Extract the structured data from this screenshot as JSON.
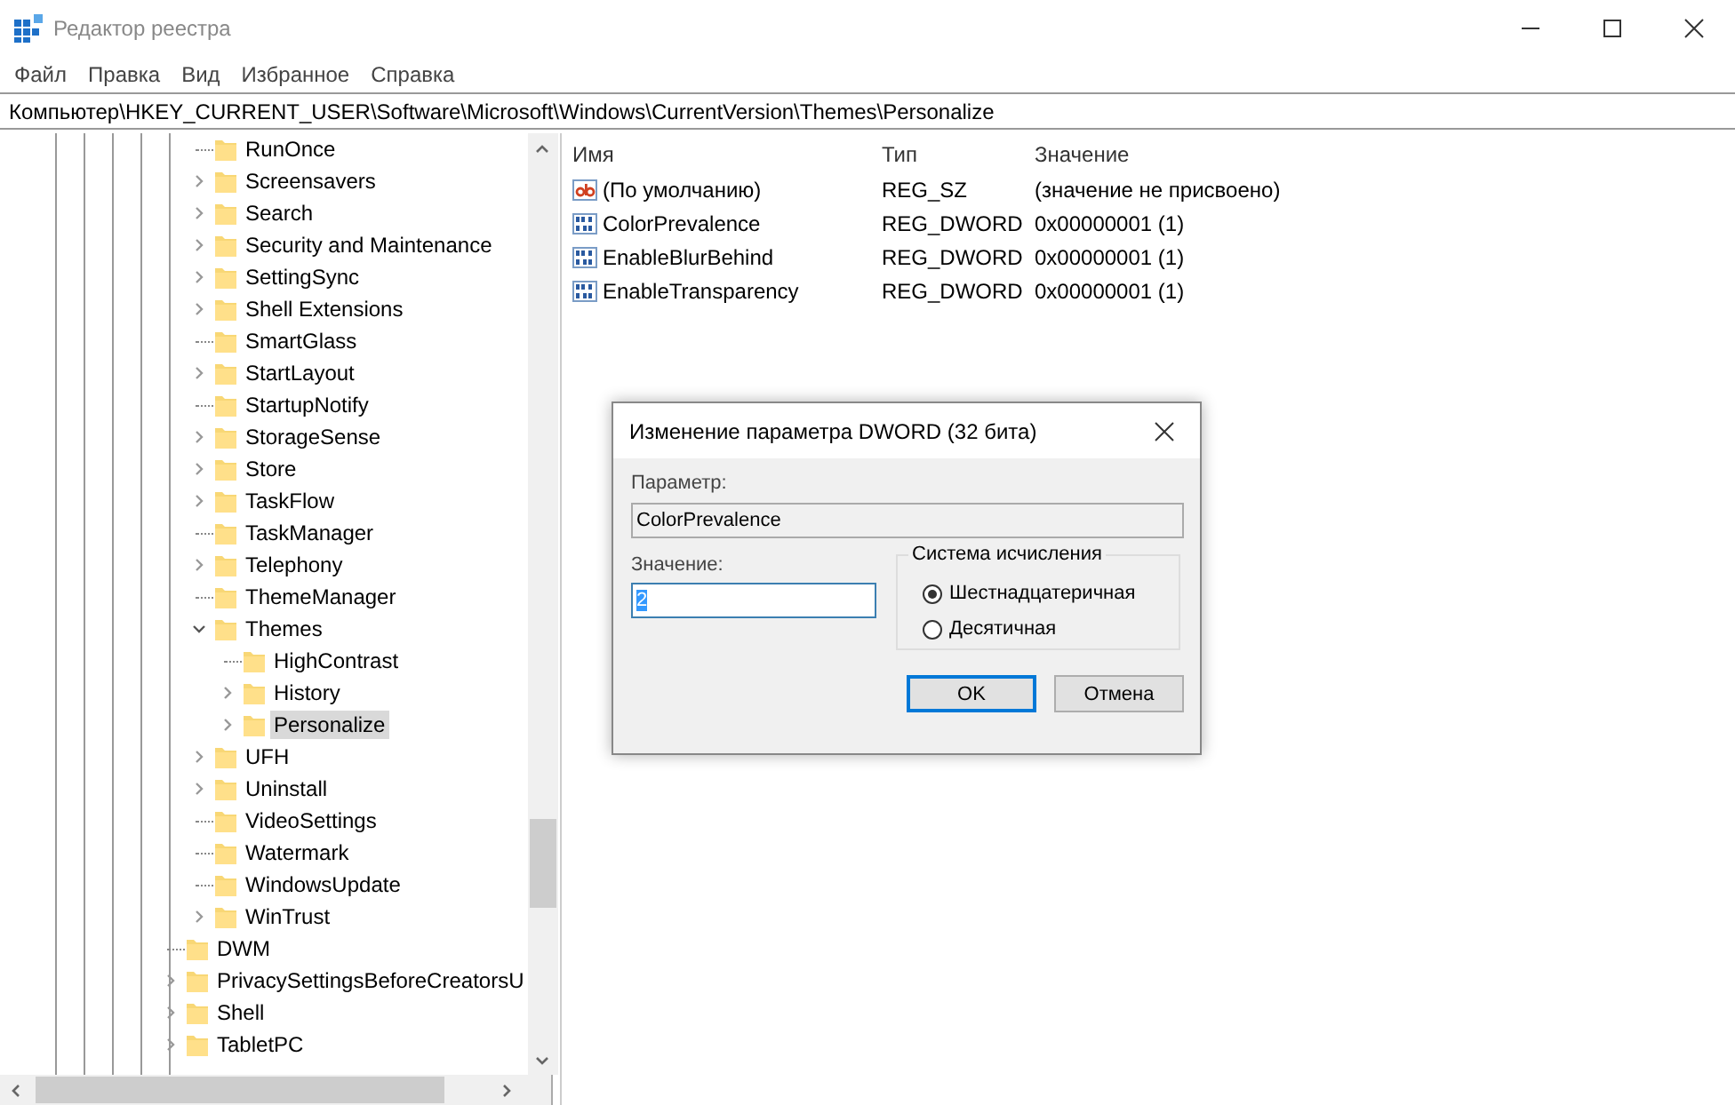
{
  "window": {
    "title": "Редактор реестра"
  },
  "menu": [
    "Файл",
    "Правка",
    "Вид",
    "Избранное",
    "Справка"
  ],
  "address": "Компьютер\\HKEY_CURRENT_USER\\Software\\Microsoft\\Windows\\CurrentVersion\\Themes\\Personalize",
  "tree": {
    "nodes": [
      {
        "label": "RunOnce",
        "kind": "leaf",
        "selected": false
      },
      {
        "label": "Screensavers",
        "kind": "branch",
        "expanded": false,
        "selected": false
      },
      {
        "label": "Search",
        "kind": "branch",
        "expanded": false,
        "selected": false
      },
      {
        "label": "Security and Maintenance",
        "kind": "branch",
        "expanded": false,
        "selected": false
      },
      {
        "label": "SettingSync",
        "kind": "branch",
        "expanded": false,
        "selected": false
      },
      {
        "label": "Shell Extensions",
        "kind": "branch",
        "expanded": false,
        "selected": false
      },
      {
        "label": "SmartGlass",
        "kind": "leaf",
        "selected": false
      },
      {
        "label": "StartLayout",
        "kind": "branch",
        "expanded": false,
        "selected": false
      },
      {
        "label": "StartupNotify",
        "kind": "leaf",
        "selected": false
      },
      {
        "label": "StorageSense",
        "kind": "branch",
        "expanded": false,
        "selected": false
      },
      {
        "label": "Store",
        "kind": "branch",
        "expanded": false,
        "selected": false
      },
      {
        "label": "TaskFlow",
        "kind": "branch",
        "expanded": false,
        "selected": false
      },
      {
        "label": "TaskManager",
        "kind": "leaf",
        "selected": false
      },
      {
        "label": "Telephony",
        "kind": "branch",
        "expanded": false,
        "selected": false
      },
      {
        "label": "ThemeManager",
        "kind": "leaf",
        "selected": false
      },
      {
        "label": "Themes",
        "kind": "branch",
        "expanded": true,
        "selected": false,
        "children": [
          {
            "label": "HighContrast",
            "kind": "leaf",
            "selected": false
          },
          {
            "label": "History",
            "kind": "branch",
            "expanded": false,
            "selected": false
          },
          {
            "label": "Personalize",
            "kind": "branch",
            "expanded": false,
            "selected": true
          }
        ]
      },
      {
        "label": "UFH",
        "kind": "branch",
        "expanded": false,
        "selected": false
      },
      {
        "label": "Uninstall",
        "kind": "branch",
        "expanded": false,
        "selected": false
      },
      {
        "label": "VideoSettings",
        "kind": "leaf",
        "selected": false
      },
      {
        "label": "Watermark",
        "kind": "leaf",
        "selected": false
      },
      {
        "label": "WindowsUpdate",
        "kind": "leaf",
        "selected": false
      },
      {
        "label": "WinTrust",
        "kind": "branch",
        "expanded": false,
        "selected": false
      }
    ],
    "outer_nodes": [
      {
        "label": "DWM",
        "kind": "leaf",
        "selected": false
      },
      {
        "label": "PrivacySettingsBeforeCreatorsU",
        "kind": "branch",
        "expanded": false,
        "selected": false
      },
      {
        "label": "Shell",
        "kind": "branch",
        "expanded": false,
        "selected": false
      },
      {
        "label": "TabletPC",
        "kind": "branch",
        "expanded": false,
        "selected": false
      }
    ]
  },
  "values": {
    "columns": [
      "Имя",
      "Тип",
      "Значение"
    ],
    "rows": [
      {
        "kind": "string",
        "name": "(По умолчанию)",
        "type": "REG_SZ",
        "data": "(значение не присвоено)"
      },
      {
        "kind": "dword",
        "name": "ColorPrevalence",
        "type": "REG_DWORD",
        "data": "0x00000001 (1)"
      },
      {
        "kind": "dword",
        "name": "EnableBlurBehind",
        "type": "REG_DWORD",
        "data": "0x00000001 (1)"
      },
      {
        "kind": "dword",
        "name": "EnableTransparency",
        "type": "REG_DWORD",
        "data": "0x00000001 (1)"
      }
    ]
  },
  "dialog": {
    "title": "Изменение параметра DWORD (32 бита)",
    "name_label": "Параметр:",
    "name_value": "ColorPrevalence",
    "value_label": "Значение:",
    "value": "2",
    "value_text_selected": true,
    "base_title": "Система исчисления",
    "radios": [
      {
        "label": "Шестнадцатеричная",
        "selected": true
      },
      {
        "label": "Десятичная",
        "selected": false
      }
    ],
    "buttons": [
      {
        "label": "OK",
        "default": true
      },
      {
        "label": "Отмена",
        "default": false
      }
    ]
  }
}
